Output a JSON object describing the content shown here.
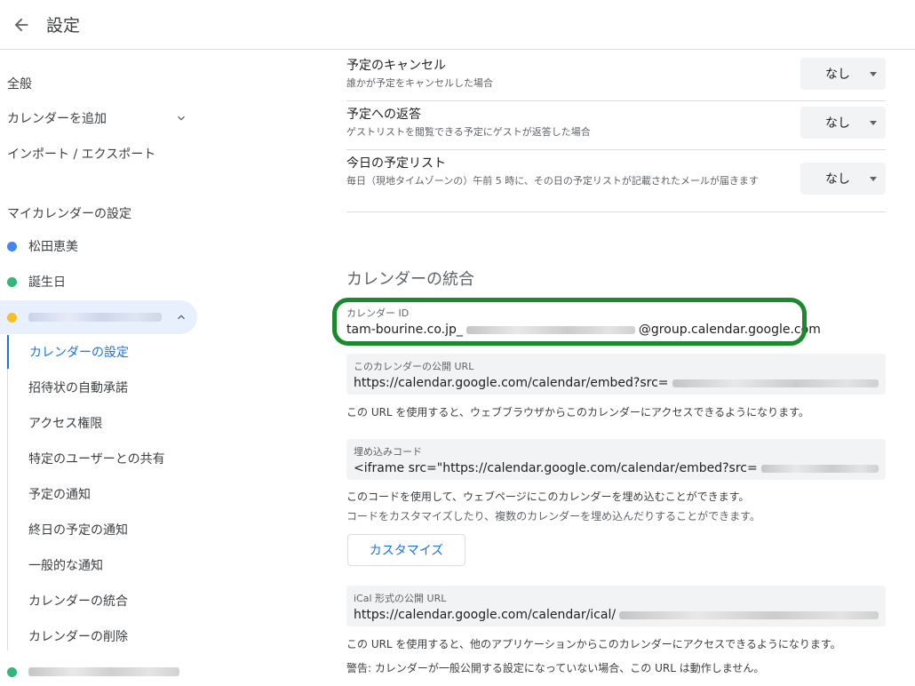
{
  "header": {
    "title": "設定"
  },
  "sidebar": {
    "general": "全般",
    "add_calendar": "カレンダーを追加",
    "import_export": "インポート / エクスポート",
    "my_calendars_heading": "マイカレンダーの設定",
    "calendars": [
      {
        "name": "松田恵美",
        "color": "#4285f4"
      },
      {
        "name": "誕生日",
        "color": "#33b679"
      },
      {
        "name": "",
        "color": "#f6bf26"
      },
      {
        "name": "",
        "color": "#33b679"
      }
    ],
    "sub_items": [
      "カレンダーの設定",
      "招待状の自動承諾",
      "アクセス権限",
      "特定のユーザーとの共有",
      "予定の通知",
      "終日の予定の通知",
      "一般的な通知",
      "カレンダーの統合",
      "カレンダーの削除"
    ]
  },
  "notifications": [
    {
      "title": "予定のキャンセル",
      "desc": "誰かが予定をキャンセルした場合",
      "value": "なし"
    },
    {
      "title": "予定への返答",
      "desc": "ゲストリストを閲覧できる予定にゲストが返答した場合",
      "value": "なし"
    },
    {
      "title": "今日の予定リスト",
      "desc": "毎日（現地タイムゾーンの）午前 5 時に、その日の予定リストが記載されたメールが届きます",
      "value": "なし"
    }
  ],
  "integration": {
    "title": "カレンダーの統合",
    "calendar_id_label": "カレンダー ID",
    "calendar_id_prefix": "tam-bourine.co.jp_",
    "calendar_id_suffix": "@group.calendar.google.com",
    "public_url_label": "このカレンダーの公開 URL",
    "public_url_prefix": "https://calendar.google.com/calendar/embed?src=",
    "public_url_help": "この URL を使用すると、ウェブブラウザからこのカレンダーにアクセスできるようになります。",
    "embed_label": "埋め込みコード",
    "embed_prefix": "<iframe src=\"https://calendar.google.com/calendar/embed?src=",
    "embed_help1": "このコードを使用して、ウェブページにこのカレンダーを埋め込むことができます。",
    "embed_help2": "コードをカスタマイズしたり、複数のカレンダーを埋め込んだりすることができます。",
    "customize_button": "カスタマイズ",
    "ical_label": "iCal 形式の公開 URL",
    "ical_prefix": "https://calendar.google.com/calendar/ical/",
    "ical_help": "この URL を使用すると、他のアプリケーションからこのカレンダーにアクセスできるようになります。",
    "warning": "警告: カレンダーが一般公開する設定になっていない場合、この URL は動作しません。"
  }
}
